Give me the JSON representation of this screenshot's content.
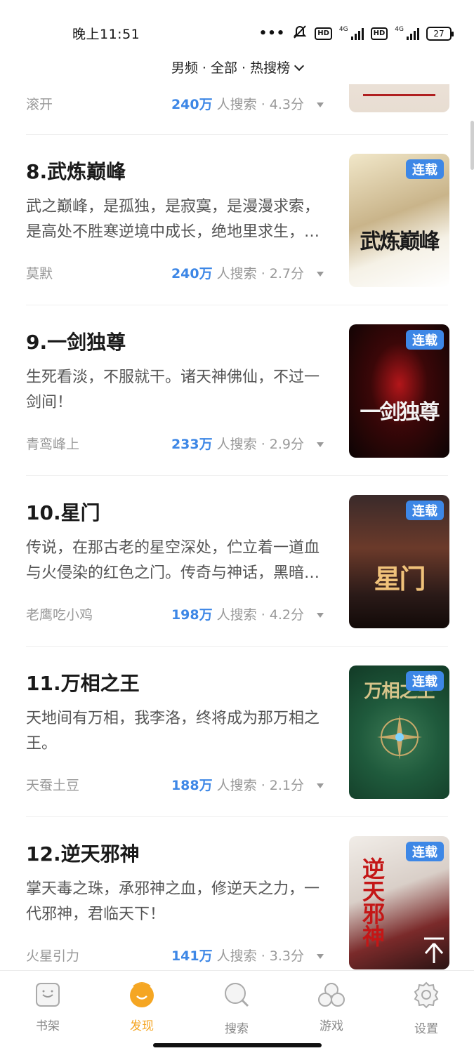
{
  "status_bar": {
    "time": "晚上11:51",
    "net_1": "4G",
    "net_2": "4G",
    "hd_1": "HD",
    "hd_2": "HD",
    "battery": "27",
    "icons": [
      "more-dots-icon",
      "mute-bell-icon",
      "hd-icon",
      "signal-icon",
      "battery-icon"
    ]
  },
  "header": {
    "filter_label": "男频 · 全部 · 热搜榜"
  },
  "list": {
    "partial_item": {
      "author": "滚开",
      "count": "240万",
      "search_label": " 人搜索",
      "score": " · 4.3分"
    },
    "items": [
      {
        "title": "8.武炼巅峰",
        "desc": "武之巅峰，是孤独，是寂寞，是漫漫求索，是高处不胜寒逆境中成长，绝地里求生，不屈不饶，才能堪破武之极道。",
        "author": "莫默",
        "count": "240万",
        "search_label": " 人搜索",
        "score": " · 2.7分",
        "badge": "连载",
        "cover_text": "武炼巅峰"
      },
      {
        "title": "9.一剑独尊",
        "desc": "生死看淡，不服就干。诸天神佛仙，不过一剑间！",
        "author": "青鸾峰上",
        "count": "233万",
        "search_label": " 人搜索",
        "score": " · 2.9分",
        "badge": "连载",
        "cover_text": "一剑独尊"
      },
      {
        "title": "10.星门",
        "desc": "传说，在那古老的星空深处，伫立着一道血与火侵染的红色之门。传奇与神话，黑暗与光明。",
        "author": "老鹰吃小鸡",
        "count": "198万",
        "search_label": " 人搜索",
        "score": " · 4.2分",
        "badge": "连载",
        "cover_text": "星门"
      },
      {
        "title": "11.万相之王",
        "desc": "天地间有万相，我李洛，终将成为那万相之王。",
        "author": "天蚕土豆",
        "count": "188万",
        "search_label": " 人搜索",
        "score": " · 2.1分",
        "badge": "连载",
        "cover_text": "万相之王"
      },
      {
        "title": "12.逆天邪神",
        "desc": "掌天毒之珠，承邪神之血，修逆天之力，一代邪神，君临天下！",
        "author": "火星引力",
        "count": "141万",
        "search_label": " 人搜索",
        "score": " · 3.3分",
        "badge": "连载",
        "cover_text": "逆天邪神"
      }
    ]
  },
  "colors": {
    "accent_blue": "#3d87e6",
    "active_orange": "#f5a623",
    "text_gray": "#999999"
  },
  "bottom_nav": [
    {
      "label": "书架",
      "icon": "bookshelf-icon",
      "active": false
    },
    {
      "label": "发现",
      "icon": "discover-icon",
      "active": true
    },
    {
      "label": "搜索",
      "icon": "search-icon",
      "active": false
    },
    {
      "label": "游戏",
      "icon": "game-icon",
      "active": false
    },
    {
      "label": "设置",
      "icon": "settings-icon",
      "active": false
    }
  ]
}
